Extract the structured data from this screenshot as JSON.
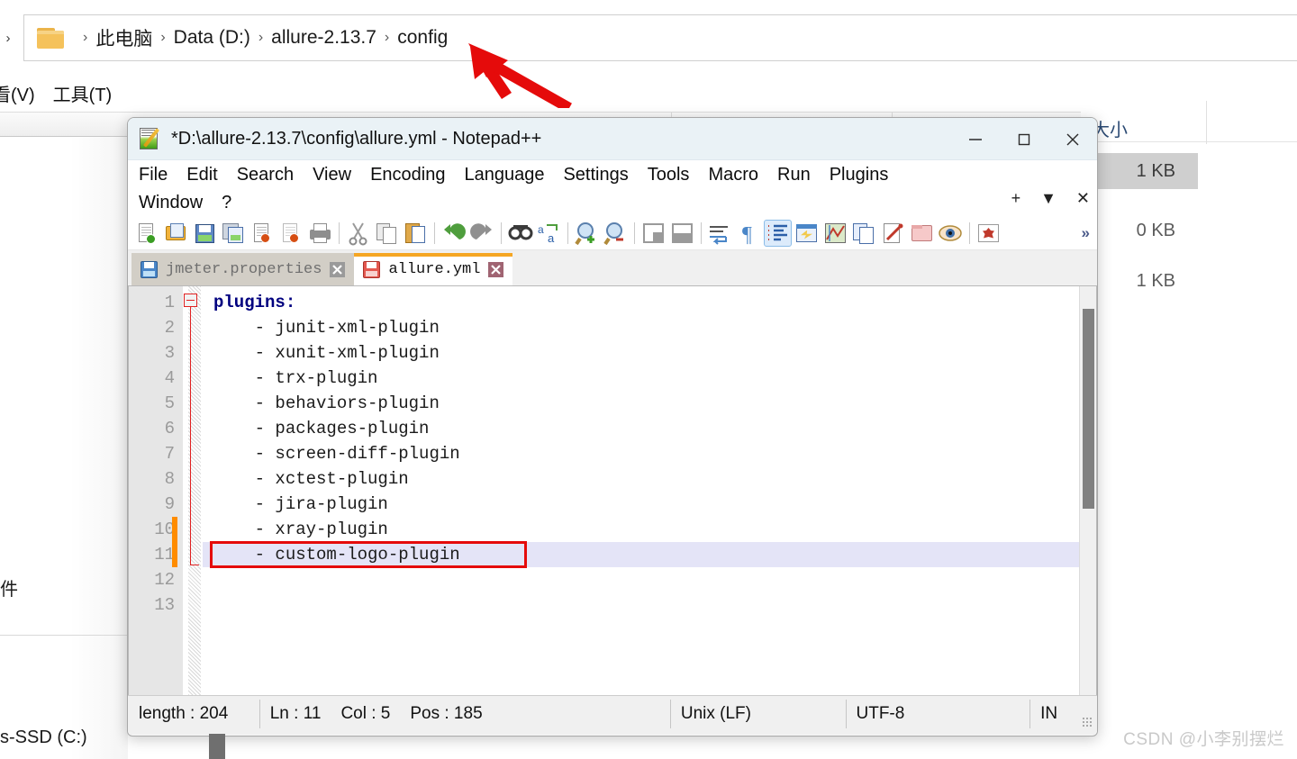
{
  "explorer": {
    "breadcrumb": {
      "back_chevron": "›",
      "folder_icon": "folder-icon",
      "items": [
        "此电脑",
        "Data (D:)",
        "allure-2.13.7",
        "config"
      ],
      "separator": "›"
    },
    "menus": [
      "看(V)",
      "工具(T)"
    ],
    "column_header": "大小",
    "sizes": [
      "1 KB",
      "0 KB",
      "1 KB"
    ],
    "left_labels": [
      "件",
      "s-SSD (C:)"
    ],
    "collapse_caret": "⌃",
    "annotation": {
      "type": "red-arrow",
      "points_to": "config"
    }
  },
  "notepad": {
    "title": "*D:\\allure-2.13.7\\config\\allure.yml - Notepad++",
    "icon": "notepad-plus-plus-icon",
    "window_buttons": {
      "minimize": "minimize-icon",
      "maximize": "maximize-icon",
      "close": "close-icon"
    },
    "menu": [
      "File",
      "Edit",
      "Search",
      "View",
      "Encoding",
      "Language",
      "Settings",
      "Tools",
      "Macro",
      "Run",
      "Plugins",
      "Window",
      "?"
    ],
    "tab_controls": {
      "add": "+",
      "list": "▼",
      "close": "✕"
    },
    "toolbar": {
      "items": [
        "new-file-icon",
        "open-file-icon",
        "save-icon",
        "save-all-icon",
        "close-file-icon",
        "close-all-icon",
        "print-icon",
        "cut-icon",
        "copy-icon",
        "paste-icon",
        "undo-icon",
        "redo-icon",
        "find-icon",
        "replace-icon",
        "zoom-in-icon",
        "zoom-out-icon",
        "sync-vertical-icon",
        "sync-horizontal-icon",
        "word-wrap-icon",
        "show-all-characters-icon",
        "show-indent-guide-icon",
        "user-defined-language-icon",
        "document-map-icon",
        "function-list-icon",
        "folder-as-workspace-icon",
        "monitoring-icon",
        "macro-record-icon"
      ],
      "overflow": "»",
      "active_item": "show-indent-guide-icon"
    },
    "tabs": [
      {
        "label": "jmeter.properties",
        "active": false,
        "icon": "save-blue-icon",
        "close": "close-icon"
      },
      {
        "label": "allure.yml",
        "active": true,
        "icon": "save-red-icon",
        "close": "close-icon"
      }
    ],
    "editor": {
      "line_numbers": [
        "1",
        "2",
        "3",
        "4",
        "5",
        "6",
        "7",
        "8",
        "9",
        "10",
        "11",
        "12",
        "13"
      ],
      "lines": [
        "plugins:",
        "    - junit-xml-plugin",
        "    - xunit-xml-plugin",
        "    - trx-plugin",
        "    - behaviors-plugin",
        "    - packages-plugin",
        "    - screen-diff-plugin",
        "    - xctest-plugin",
        "    - jira-plugin",
        "    - xray-plugin",
        "    - custom-logo-plugin",
        "",
        ""
      ],
      "keyword_line": "plugins:",
      "highlighted_line_number": 11,
      "highlighted_line_text": "    - custom-logo-plugin",
      "annotation_box_line": 11,
      "changed_lines": [
        10,
        11
      ],
      "fold_at_line": 1
    },
    "status": {
      "length": "length : 204",
      "ln": "Ln : 11",
      "col": "Col : 5",
      "pos": "Pos : 185",
      "eol": "Unix (LF)",
      "encoding": "UTF-8",
      "insert_mode": "IN"
    }
  },
  "watermark": "CSDN @小李别摆烂",
  "colors": {
    "tab_active_accent": "#f5a623",
    "annotation_red": "#e50b0b",
    "change_marker": "#ff8c00",
    "keyword_blue": "#00007f",
    "highlight_line": "#e4e4f7",
    "title_bg": "#eaf2f6"
  }
}
